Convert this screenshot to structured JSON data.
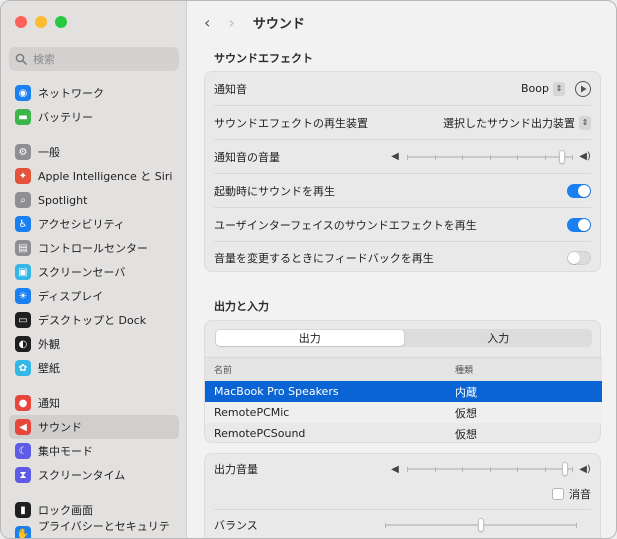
{
  "window": {
    "traffic_colors": [
      "#fe5f57",
      "#febc2e",
      "#28c840"
    ]
  },
  "sidebar": {
    "search_placeholder": "検索",
    "groups": [
      [
        {
          "label": "ネットワーク",
          "icon": "network-icon",
          "color": "#1a7ff0"
        },
        {
          "label": "バッテリー",
          "icon": "battery-icon",
          "color": "#3cb64a"
        }
      ],
      [
        {
          "label": "一般",
          "icon": "gear-icon",
          "color": "#8e8e93"
        },
        {
          "label": "Apple Intelligence と Siri",
          "icon": "siri-icon",
          "color": "#e2533a"
        },
        {
          "label": "Spotlight",
          "icon": "spotlight-icon",
          "color": "#8e8e93"
        },
        {
          "label": "アクセシビリティ",
          "icon": "accessibility-icon",
          "color": "#1a7ff0"
        },
        {
          "label": "コントロールセンター",
          "icon": "control-center-icon",
          "color": "#8e8e93"
        },
        {
          "label": "スクリーンセーバ",
          "icon": "screensaver-icon",
          "color": "#34b7e6"
        },
        {
          "label": "ディスプレイ",
          "icon": "display-icon",
          "color": "#1a7ff0"
        },
        {
          "label": "デスクトップと Dock",
          "icon": "dock-icon",
          "color": "#1f1f1f"
        },
        {
          "label": "外観",
          "icon": "appearance-icon",
          "color": "#1f1f1f"
        },
        {
          "label": "壁紙",
          "icon": "wallpaper-icon",
          "color": "#34b7e6"
        }
      ],
      [
        {
          "label": "通知",
          "icon": "bell-icon",
          "color": "#e8453c"
        },
        {
          "label": "サウンド",
          "icon": "speaker-icon",
          "color": "#e8453c",
          "selected": true
        },
        {
          "label": "集中モード",
          "icon": "moon-icon",
          "color": "#5e5ce6"
        },
        {
          "label": "スクリーンタイム",
          "icon": "hourglass-icon",
          "color": "#5e5ce6"
        }
      ],
      [
        {
          "label": "ロック画面",
          "icon": "lock-icon",
          "color": "#1f1f1f"
        },
        {
          "label": "プライバシーとセキュリティ",
          "icon": "hand-icon",
          "color": "#1a7ff0"
        }
      ]
    ]
  },
  "header": {
    "back": "‹",
    "forward": "›",
    "title": "サウンド"
  },
  "sound_effects": {
    "section_title": "サウンドエフェクト",
    "alert_sound_label": "通知音",
    "alert_sound_value": "Boop",
    "play_output_label": "サウンドエフェクトの再生装置",
    "play_output_value": "選択したサウンド出力装置",
    "alert_volume_label": "通知音の音量",
    "alert_volume_level": 0.95,
    "startup_label": "起動時にサウンドを再生",
    "startup_on": true,
    "ui_effects_label": "ユーザインターフェイスのサウンドエフェクトを再生",
    "ui_effects_on": true,
    "feedback_label": "音量を変更するときにフィードバックを再生",
    "feedback_on": false
  },
  "output_input": {
    "section_title": "出力と入力",
    "tabs": [
      "出力",
      "入力"
    ],
    "active_tab": 0,
    "columns": [
      "名前",
      "種類"
    ],
    "devices": [
      {
        "name": "MacBook Pro Speakers",
        "type": "内蔵",
        "selected": true
      },
      {
        "name": "RemotePCMic",
        "type": "仮想"
      },
      {
        "name": "RemotePCSound",
        "type": "仮想"
      }
    ]
  },
  "output": {
    "volume_label": "出力音量",
    "volume_level": 0.97,
    "mute_label": "消音",
    "mute_checked": false,
    "balance_label": "バランス",
    "balance_level": 0.5
  }
}
